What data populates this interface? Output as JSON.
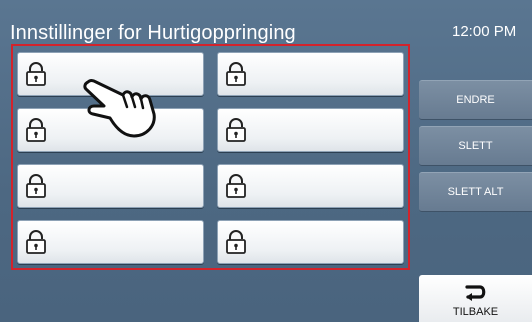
{
  "header": {
    "title": "Innstillinger for Hurtigoppringing",
    "clock": "12:00 PM"
  },
  "speed_dial": {
    "slots": [
      {
        "icon": "lock-icon",
        "label": ""
      },
      {
        "icon": "lock-icon",
        "label": ""
      },
      {
        "icon": "lock-icon",
        "label": ""
      },
      {
        "icon": "lock-icon",
        "label": ""
      },
      {
        "icon": "lock-icon",
        "label": ""
      },
      {
        "icon": "lock-icon",
        "label": ""
      },
      {
        "icon": "lock-icon",
        "label": ""
      },
      {
        "icon": "lock-icon",
        "label": ""
      }
    ]
  },
  "side_menu": {
    "edit_label": "ENDRE",
    "delete_label": "SLETT",
    "delete_all_label": "SLETT ALT",
    "back_label": "TILBAKE"
  },
  "colors": {
    "background": "#4f6a85",
    "highlight": "#d3232b",
    "slot_button": "#ffffff"
  }
}
